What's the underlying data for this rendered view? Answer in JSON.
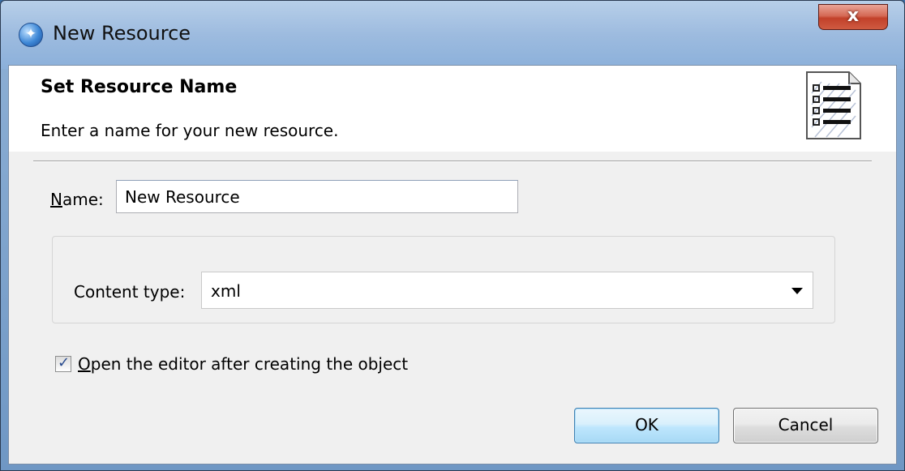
{
  "window": {
    "title": "New Resource",
    "close_glyph": "x",
    "app_icon": "eclipse-globe-icon"
  },
  "header": {
    "title": "Set Resource Name",
    "description": "Enter a name for your new resource.",
    "icon": "document-list-icon"
  },
  "form": {
    "name_label_mnemonic": "N",
    "name_label_rest": "ame:",
    "name_value": "New Resource",
    "content_type_label": "Content type:",
    "content_type_value": "xml",
    "open_editor_checked": true,
    "open_editor_mnemonic": "O",
    "open_editor_rest": "pen the editor after creating the object"
  },
  "buttons": {
    "ok_label": "OK",
    "cancel_label": "Cancel"
  },
  "colors": {
    "titlebar": "#9dbbdf",
    "close_button": "#c2412a",
    "dialog_background": "#f0f0f0",
    "default_button_border": "#3c7fb1"
  }
}
